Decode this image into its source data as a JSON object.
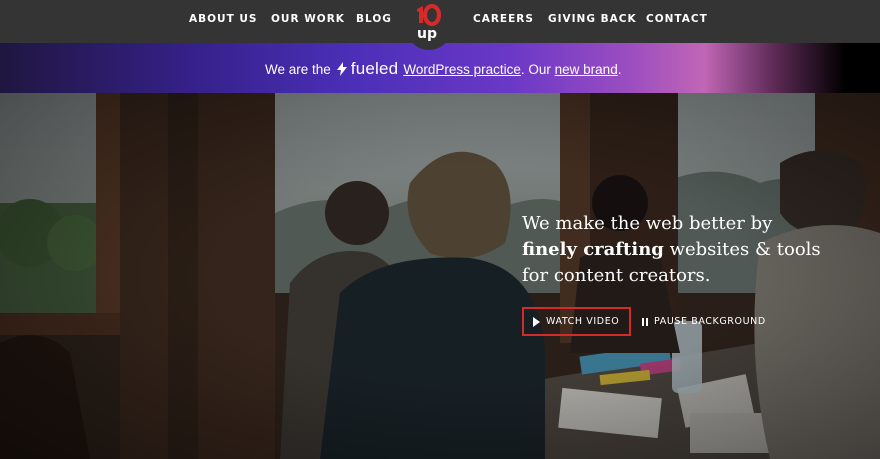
{
  "nav": {
    "left_links": [
      "ABOUT US",
      "OUR WORK",
      "BLOG"
    ],
    "right_links": [
      "CAREERS",
      "GIVING BACK",
      "CONTACT"
    ],
    "logo": {
      "text": "10up",
      "color": "#d42a2a"
    }
  },
  "banner": {
    "prefix": "We are the",
    "brand": "fueled",
    "link1": "WordPress practice",
    "middle": ". Our",
    "link2": "new brand",
    "suffix": "."
  },
  "hero": {
    "line1": "We make the web better by",
    "emphasis": "finely crafting",
    "line2_rest": " websites & tools",
    "line3": "for content creators.",
    "watch_label": "WATCH VIDEO",
    "pause_label": "PAUSE BACKGROUND"
  },
  "icons": {
    "bolt": "bolt-icon",
    "play": "play-icon",
    "pause": "pause-icon"
  },
  "colors": {
    "nav_bg": "#343434",
    "accent_red": "#d42a2a",
    "banner_purple": "#4b2fb8",
    "banner_pink": "#c166b6"
  }
}
